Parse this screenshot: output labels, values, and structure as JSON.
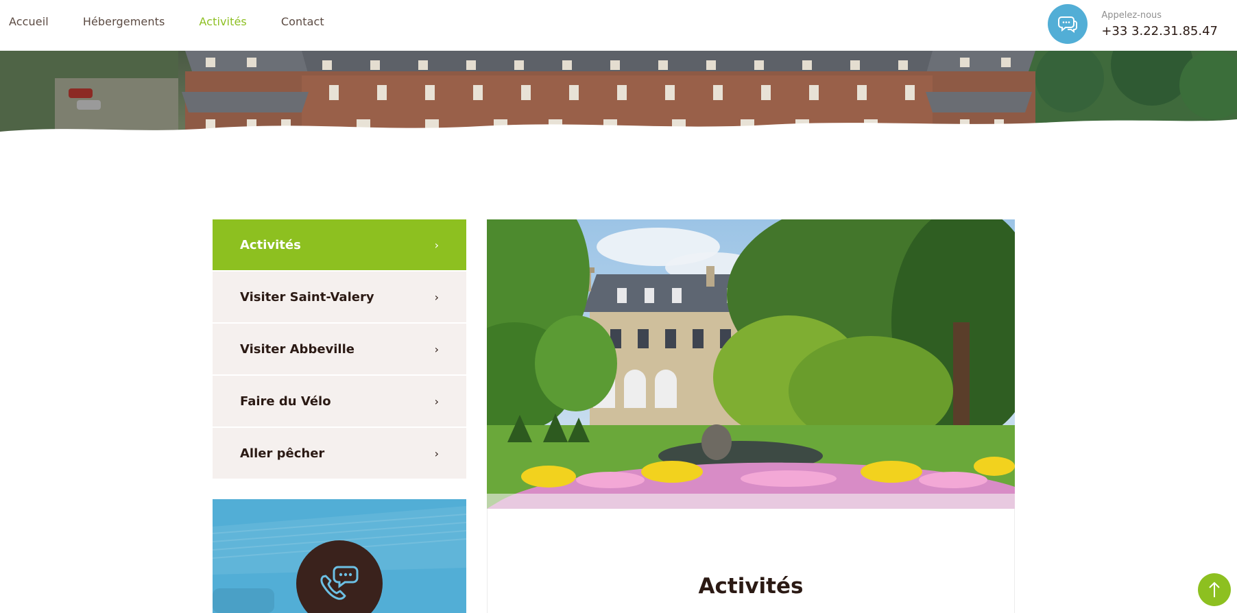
{
  "nav": {
    "items": [
      {
        "label": "Accueil",
        "active": false
      },
      {
        "label": "Hébergements",
        "active": false
      },
      {
        "label": "Activités",
        "active": true
      },
      {
        "label": "Contact",
        "active": false
      }
    ]
  },
  "call": {
    "label": "Appelez-nous",
    "number": "+33 3.22.31.85.47",
    "icon": "chat-bubbles-icon"
  },
  "sidebar": {
    "items": [
      {
        "label": "Activités",
        "active": true
      },
      {
        "label": "Visiter Saint-Valery",
        "active": false
      },
      {
        "label": "Visiter Abbeville",
        "active": false
      },
      {
        "label": "Faire du Vélo",
        "active": false
      },
      {
        "label": "Aller pêcher",
        "active": false
      }
    ],
    "chevron": "›",
    "contact_icon": "phone-chat-icon"
  },
  "main": {
    "title": "Activités"
  },
  "back_to_top_icon": "arrow-up-icon",
  "colors": {
    "accent_green": "#8dc020",
    "accent_blue": "#52aed6",
    "dark_brown": "#2b1a14",
    "light_bg": "#f5f0ee"
  }
}
